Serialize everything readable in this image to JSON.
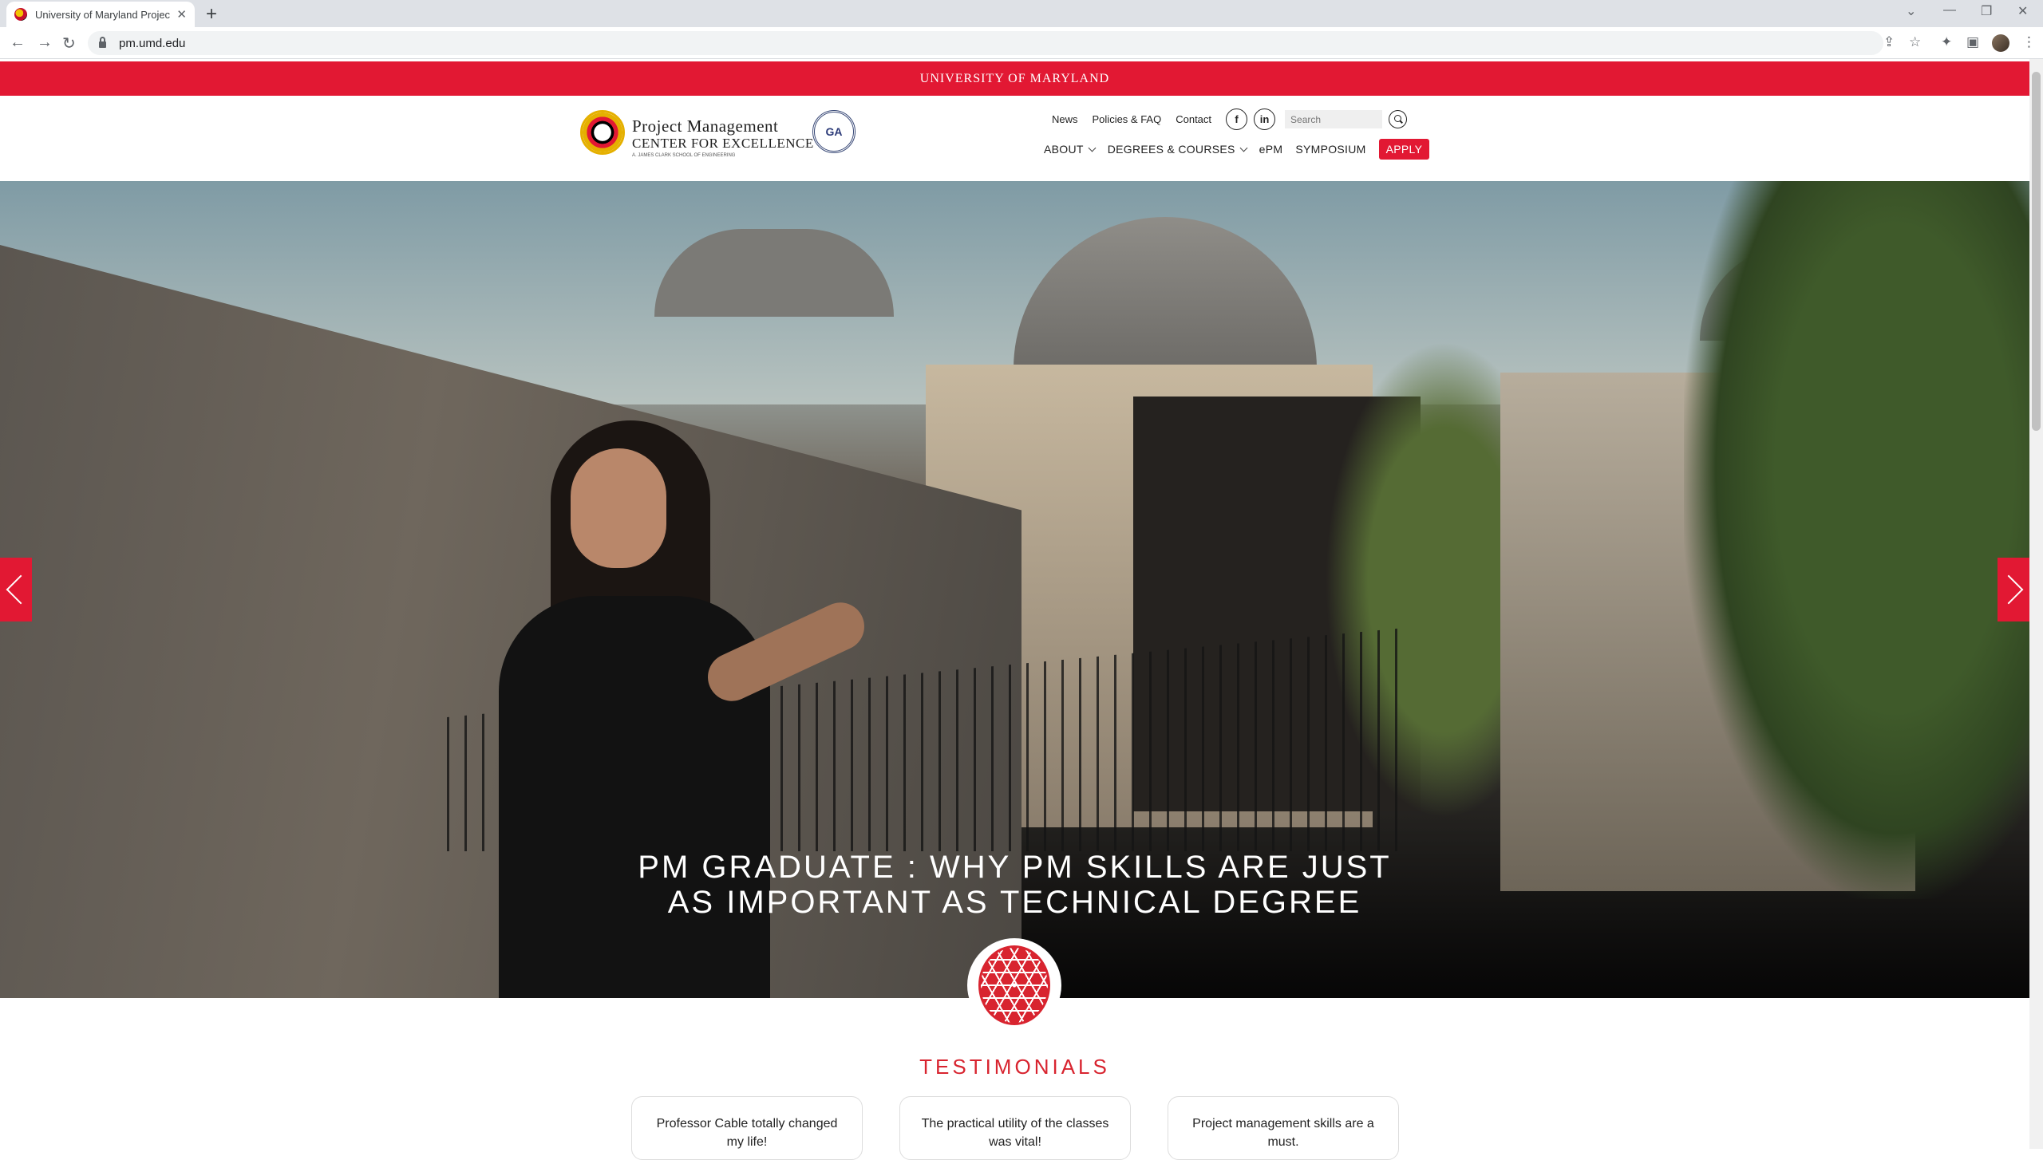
{
  "browser": {
    "tab_title": "University of Maryland Project M",
    "tab_close": "✕",
    "new_tab": "+",
    "url": "pm.umd.edu",
    "back": "←",
    "forward": "→",
    "reload": "↻",
    "minimize": "—",
    "restore": "❐",
    "close": "✕",
    "share": "⇪",
    "star": "☆",
    "extensions": "✦",
    "sidepanel": "▣",
    "menu": "⋮",
    "tab_menu": "⌄"
  },
  "site": {
    "banner": "UNIVERSITY OF MARYLAND",
    "logo_line1": "Project Management",
    "logo_line2": "CENTER FOR EXCELLENCE",
    "logo_line3": "A. JAMES CLARK SCHOOL OF ENGINEERING",
    "badge": "GA",
    "topnav": {
      "news": "News",
      "policies": "Policies & FAQ",
      "contact": "Contact",
      "facebook": "f",
      "linkedin": "in",
      "search_placeholder": "Search"
    },
    "mainnav": {
      "about": "ABOUT",
      "degrees": "DEGREES & COURSES",
      "epm": "ePM",
      "symposium": "SYMPOSIUM",
      "apply": "APPLY"
    }
  },
  "hero": {
    "title_line1": "PM GRADUATE : WHY PM SKILLS ARE JUST",
    "title_line2": "AS IMPORTANT AS TECHNICAL DEGREE"
  },
  "testimonials": {
    "heading": "TESTIMONIALS",
    "cards": [
      {
        "text": "Professor Cable totally changed my life!"
      },
      {
        "text": "The practical utility of the classes was vital!"
      },
      {
        "text": "Project management skills are a must."
      }
    ]
  },
  "colors": {
    "brand_red": "#e21833",
    "testimonial_red": "#d8242f"
  }
}
